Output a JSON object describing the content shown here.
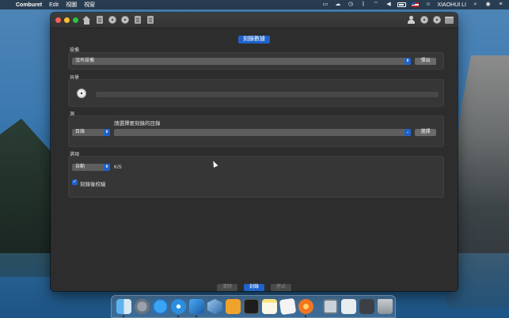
{
  "menubar": {
    "app_name": "Comburet",
    "menus": [
      "Edit",
      "視圖",
      "視窗"
    ],
    "user_name": "XIAOHUI LI"
  },
  "window": {
    "page_tab_label": "刻錄數據",
    "device": {
      "section_label": "設備",
      "selected": "沒有設備",
      "eject_label": "彈出"
    },
    "capacity": {
      "section_label": "容量",
      "fill": 0
    },
    "source": {
      "section_label": "源",
      "hint": "請選擇要刻錄的目錄",
      "type_selected": "目錄",
      "path_value": "",
      "choose_label": "選擇"
    },
    "options": {
      "section_label": "選項",
      "speed_selected": "自動",
      "speed_unit": "K/S",
      "verify_label": "刻錄後校驗",
      "verify_checked": true
    },
    "buttons": {
      "clear_label": "清除",
      "burn_label": "刻錄",
      "stop_label": "停止"
    }
  },
  "dock": {
    "apps": [
      "finder",
      "launchpad",
      "app-store",
      "safari",
      "xcode",
      "virtualbox",
      "sublime-text",
      "terminal",
      "notes",
      "textedit",
      "burn",
      "preview",
      "screenshot",
      "monitor",
      "trash"
    ]
  },
  "colors": {
    "accent": "#1f63c9",
    "window_bg": "#2d2d2d"
  }
}
